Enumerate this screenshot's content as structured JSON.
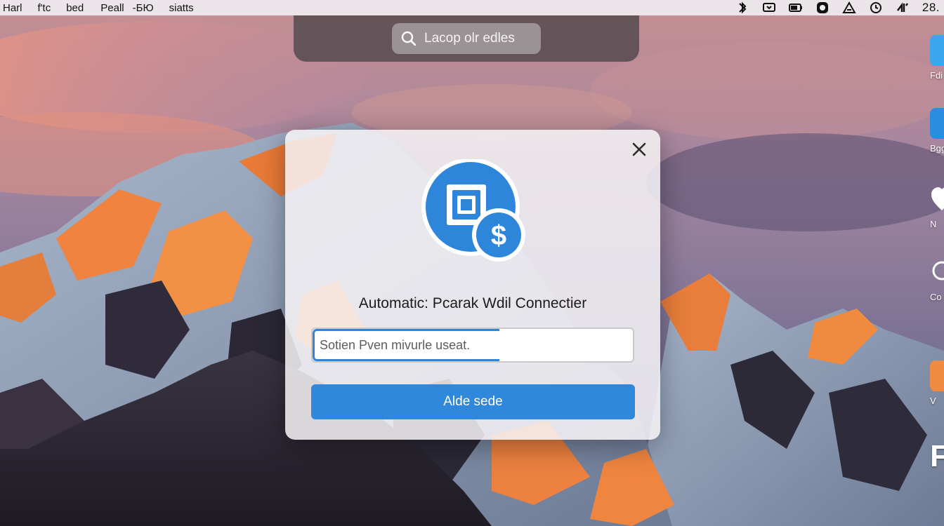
{
  "menubar": {
    "items": [
      "Harl",
      "f'tc",
      "bed",
      "Peall",
      "-БЮ",
      "siatts"
    ],
    "clock": "28."
  },
  "spotlight": {
    "placeholder": "Lacop olr edles"
  },
  "side_items": [
    "Fdi",
    "Bgg",
    "N",
    "Co",
    "V",
    "Fi"
  ],
  "dialog": {
    "title": "Automatic: Pcarak Wdil Connectier",
    "input_placeholder": "Sotien Pven mivurle useat.",
    "button_label": "Alde sede"
  },
  "colors": {
    "accent": "#2f88dc",
    "dialog_bg": "#f6f3f6",
    "icon_blue": "#2e86db"
  },
  "icons": [
    "search-icon",
    "close-icon",
    "app-icon",
    "wifi-icon",
    "battery-icon",
    "clock-icon"
  ]
}
